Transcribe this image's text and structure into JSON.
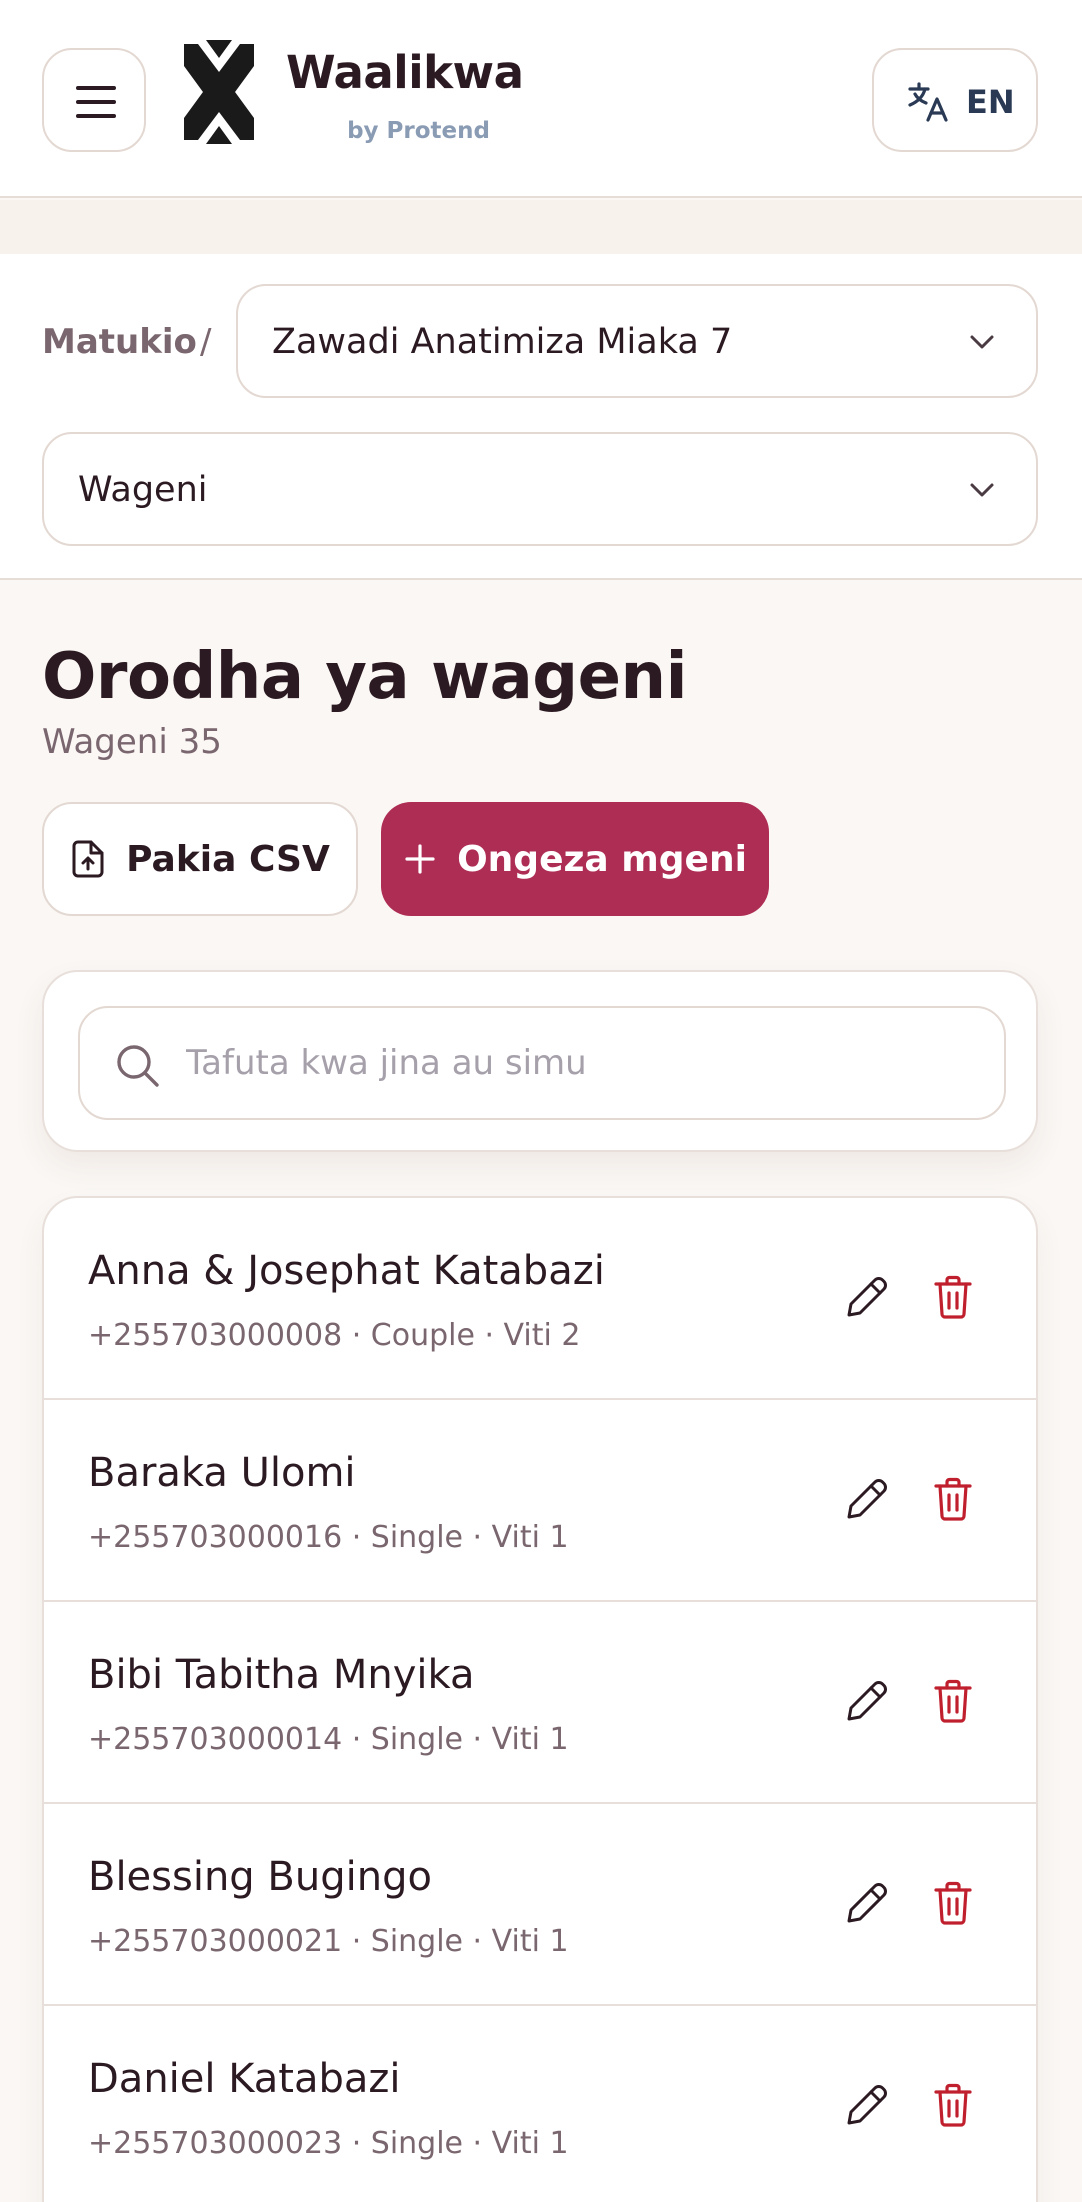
{
  "header": {
    "brand_name": "Waalikwa",
    "brand_sub": "by Protend",
    "lang_label": "EN"
  },
  "breadcrumb": {
    "root": "Matukio",
    "separator": "/",
    "event": "Zawadi Anatimiza Miaka 7"
  },
  "section_select": {
    "value": "Wageni"
  },
  "main": {
    "title": "Orodha ya wageni",
    "subtitle": "Wageni 35",
    "upload_label": "Pakia CSV",
    "add_label": "Ongeza mgeni",
    "search_placeholder": "Tafuta kwa jina au simu"
  },
  "guests": [
    {
      "name": "Anna & Josephat Katabazi",
      "meta": "+255703000008 · Couple · Viti 2"
    },
    {
      "name": "Baraka Ulomi",
      "meta": "+255703000016 · Single · Viti 1"
    },
    {
      "name": "Bibi Tabitha Mnyika",
      "meta": "+255703000014 · Single · Viti 1"
    },
    {
      "name": "Blessing Bugingo",
      "meta": "+255703000021 · Single · Viti 1"
    },
    {
      "name": "Daniel Katabazi",
      "meta": "+255703000023 · Single · Viti 1"
    }
  ],
  "colors": {
    "accent": "#ae2d55",
    "delete": "#c0202e",
    "background": "#faf7f4"
  },
  "icons": {
    "menu": "hamburger-icon",
    "logo": "waalikwa-logo",
    "language": "translate-icon",
    "chevron": "chevron-down-icon",
    "upload": "file-upload-icon",
    "add": "plus-icon",
    "search": "search-icon",
    "edit": "pencil-icon",
    "delete": "trash-icon"
  }
}
